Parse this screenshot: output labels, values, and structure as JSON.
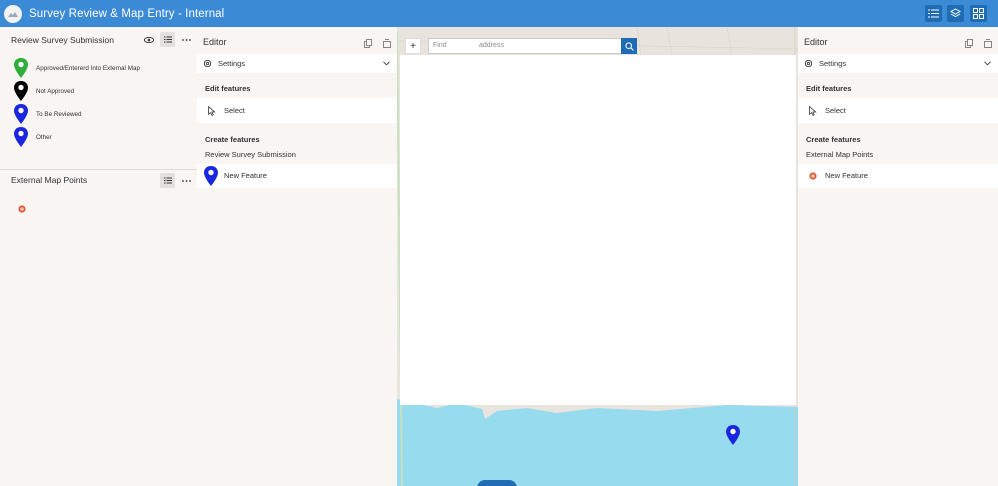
{
  "header": {
    "title": "Survey Review & Map Entry - Internal",
    "buttons": [
      "list-icon",
      "layers-icon",
      "grid-icon"
    ]
  },
  "legend": {
    "layer1_title": "Review Survey Submission",
    "items": [
      {
        "label": "Approved/Entererd Into External Map",
        "color": "#2fae3b"
      },
      {
        "label": "Not Approved",
        "color": "#000000"
      },
      {
        "label": "To Be Reviewed",
        "color": "#1a26e0"
      },
      {
        "label": "Other",
        "color": "#1a26e0"
      }
    ],
    "layer2_title": "External Map Points"
  },
  "editor_left": {
    "title": "Editor",
    "settings_label": "Settings",
    "edit_features_label": "Edit features",
    "select_label": "Select",
    "create_features_label": "Create features",
    "layer_name": "Review Survey Submission",
    "new_feature_label": "New Feature"
  },
  "editor_right": {
    "title": "Editor",
    "settings_label": "Settings",
    "edit_features_label": "Edit features",
    "select_label": "Select",
    "create_features_label": "Create features",
    "layer_name": "External Map Points",
    "new_feature_label": "New Feature"
  },
  "map": {
    "zoom_in_label": "+",
    "search_placeholder_find": "Find",
    "search_placeholder_address": "address",
    "water_color": "#97dbef",
    "marker_color": "#1a26e0"
  }
}
